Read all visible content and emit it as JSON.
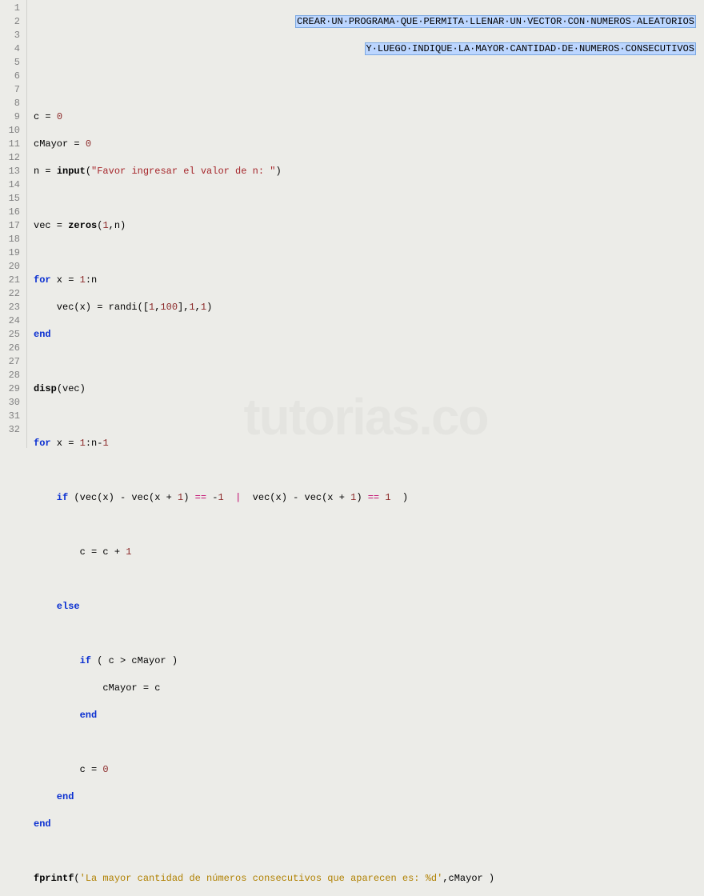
{
  "header": {
    "line1": "CREAR·UN·PROGRAMA·QUE·PERMITA·LLENAR·UN·VECTOR·CON·NUMEROS·ALEATORIOS",
    "line2": "Y·LUEGO·INDIQUE·LA·MAYOR·CANTIDAD·DE·NUMEROS·CONSECUTIVOS"
  },
  "lines": {
    "count": 32
  },
  "code": {
    "l4_var": "c",
    "l4_eq": " = ",
    "l4_val": "0",
    "l5_var": "cMayor",
    "l5_eq": " = ",
    "l5_val": "0",
    "l6_var": "n",
    "l6_eq": " = ",
    "l6_fn": "input",
    "l6_open": "(",
    "l6_str": "\"Favor ingresar el valor de n: \"",
    "l6_close": ")",
    "l8_var": "vec",
    "l8_eq": " = ",
    "l8_fn": "zeros",
    "l8_open": "(",
    "l8_a1": "1",
    "l8_comma": ",",
    "l8_a2": "n)",
    "l10_for": "for",
    "l10_rest": " x = ",
    "l10_n1": "1",
    "l10_colon": ":n",
    "l11_lhs": "    vec(x) = randi([",
    "l11_n1": "1",
    "l11_c1": ",",
    "l11_n2": "100",
    "l11_mid": "],",
    "l11_n3": "1",
    "l11_c2": ",",
    "l11_n4": "1",
    "l11_close": ")",
    "l12_end": "end",
    "l14_fn": "disp",
    "l14_arg": "(vec)",
    "l16_for": "for",
    "l16_rest": " x = ",
    "l16_n1": "1",
    "l16_mid": ":n-",
    "l16_n2": "1",
    "l18_if": "    if",
    "l18_a": " (vec(x) - vec(x + ",
    "l18_one1": "1",
    "l18_b": ") ",
    "l18_eq1": "==",
    "l18_c": " -",
    "l18_neg1": "1",
    "l18_d": "  ",
    "l18_pipe": "|",
    "l18_e": "  vec(x) - vec(x + ",
    "l18_one2": "1",
    "l18_f": ") ",
    "l18_eq2": "==",
    "l18_g": " ",
    "l18_one3": "1",
    "l18_h": "  )",
    "l20_a": "        c = c + ",
    "l20_n": "1",
    "l22_else": "    else",
    "l24_if": "        if",
    "l24_rest": " ( c > cMayor )",
    "l25": "            cMayor = c",
    "l26_end": "        end",
    "l28_a": "        c = ",
    "l28_n": "0",
    "l29_end": "    end",
    "l30_end": "end",
    "l32_fn": "fprintf",
    "l32_open": "(",
    "l32_str": "'La mayor cantidad de números consecutivos que aparecen es: %d'",
    "l32_rest": ",cMayor )"
  },
  "watermark": "tutorias.co"
}
